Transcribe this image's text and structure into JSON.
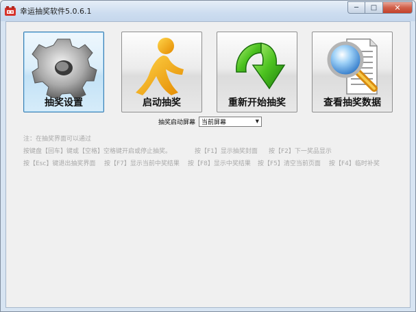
{
  "window": {
    "title": "幸运抽奖软件5.0.6.1",
    "controls": {
      "minimize": "─",
      "maximize": "□",
      "close": "✕"
    }
  },
  "buttons": [
    {
      "label": "抽奖设置",
      "icon": "gear-icon",
      "active": true
    },
    {
      "label": "启动抽奖",
      "icon": "running-person-icon",
      "active": false
    },
    {
      "label": "重新开始抽奖",
      "icon": "green-arrow-icon",
      "active": false
    },
    {
      "label": "查看抽奖数据",
      "icon": "magnifier-document-icon",
      "active": false
    }
  ],
  "screen_select": {
    "label": "抽奖启动屏幕",
    "value": "当前屏幕"
  },
  "hints": {
    "note": "注：在抽奖界面可以通过",
    "line2": [
      "按键盘【回车】键或【空格】空格键开启或停止抽奖。",
      "按【F1】显示抽奖封面",
      "按【F2】下一奖品显示"
    ],
    "line3": [
      "按【Esc】键退出抽奖界面",
      "按【F7】显示当前中奖结果",
      "按【F8】显示中奖结果",
      "按【F5】清空当前页面",
      "按【F4】临时补奖"
    ]
  },
  "colors": {
    "gear": "#b8b8b8",
    "person": "#f2a100",
    "arrow": "#3cb41c",
    "magnifier": "#4a8fd8"
  }
}
